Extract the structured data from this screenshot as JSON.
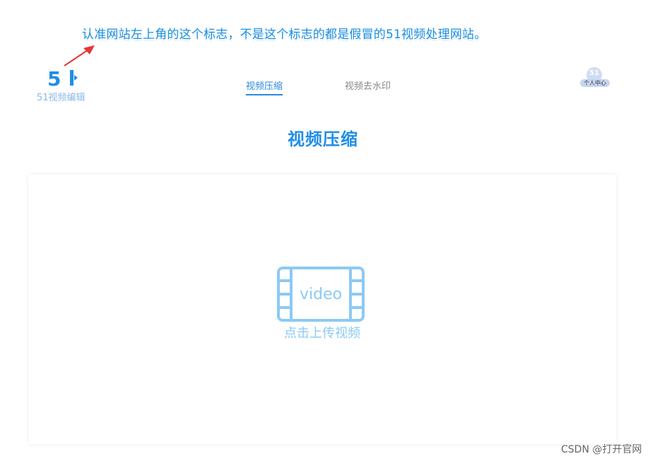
{
  "annotation": {
    "text": "认准网站左上角的这个标志，不是这个标志的都是假冒的51视频处理网站。"
  },
  "logo": {
    "mark_text": "5",
    "name": "51视频编辑"
  },
  "nav": {
    "tabs": [
      {
        "label": "视频压缩",
        "active": true
      },
      {
        "label": "视频去水印",
        "active": false
      }
    ]
  },
  "user": {
    "avatar_text": "51",
    "label": "个人中心"
  },
  "main": {
    "title": "视频压缩",
    "upload": {
      "icon_text": "video",
      "label": "点击上传视频"
    }
  },
  "watermark": {
    "text": "CSDN @打开官网"
  },
  "colors": {
    "primary": "#1f8ee8",
    "annotation": "#1a8fe0",
    "arrow": "#e53935",
    "icon": "#8ccaf4",
    "nav_inactive": "#888888"
  }
}
